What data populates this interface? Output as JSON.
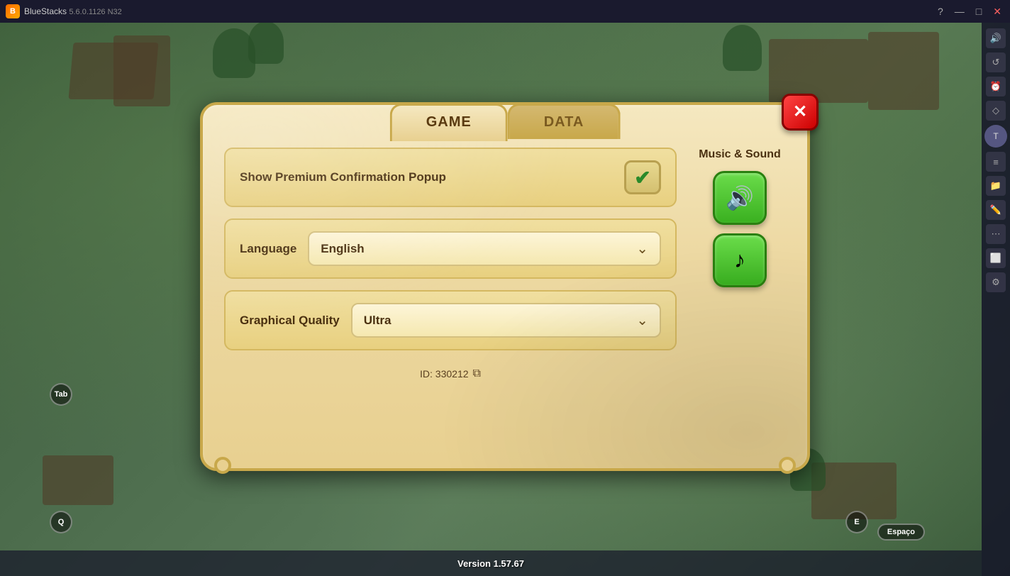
{
  "titlebar": {
    "app_name": "BlueStacks",
    "version": "5.6.0.1126  N32",
    "controls": {
      "help": "?",
      "minimize": "—",
      "maximize": "□",
      "close": "✕"
    }
  },
  "modal": {
    "tabs": [
      {
        "id": "game",
        "label": "GAME",
        "active": true
      },
      {
        "id": "data",
        "label": "DATA",
        "active": false
      }
    ],
    "close_label": "✕",
    "settings": {
      "show_premium": {
        "label": "Show Premium Confirmation Popup",
        "checked": true
      },
      "language": {
        "label": "Language",
        "value": "English"
      },
      "graphical_quality": {
        "label": "Graphical Quality",
        "value": "Ultra"
      }
    },
    "sound_section": {
      "title": "Music &\nSound",
      "sound_on_icon": "🔊",
      "music_icon": "♪"
    },
    "id_text": "ID: 330212",
    "copy_icon": "⧉"
  },
  "bottom_bar": {
    "version_text": "Version 1.57.67"
  },
  "labels": {
    "tab_label": "Tab",
    "q_label": "Q",
    "e_label": "E",
    "espaco_label": "Espaço",
    "t_label": "T"
  }
}
